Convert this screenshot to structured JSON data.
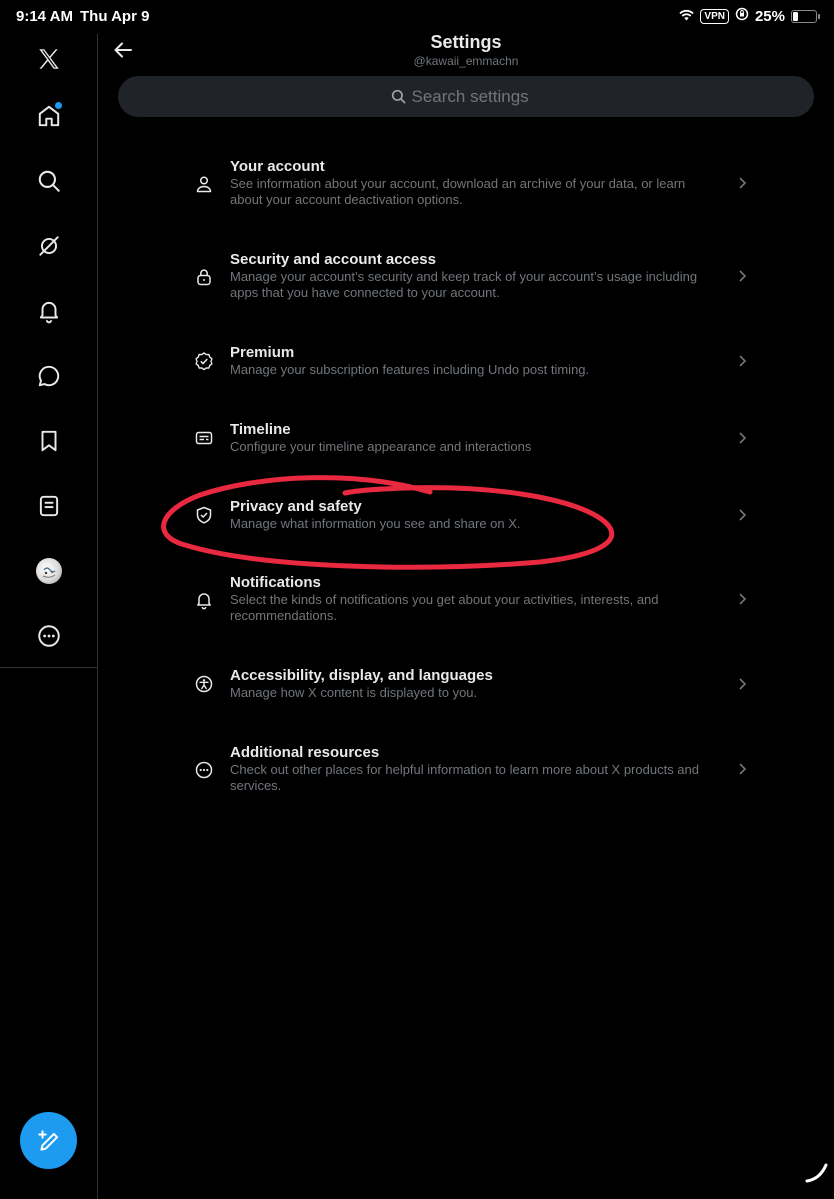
{
  "status_bar": {
    "time": "9:14 AM",
    "date": "Thu Apr 9",
    "vpn_label": "VPN",
    "battery_percent": "25%",
    "battery_level": 0.25
  },
  "sidebar": {
    "items": [
      {
        "name": "x-logo",
        "icon": "x-logo-icon"
      },
      {
        "name": "home",
        "icon": "home-icon",
        "has_notification_dot": true
      },
      {
        "name": "explore",
        "icon": "search-icon"
      },
      {
        "name": "grok",
        "icon": "grok-icon"
      },
      {
        "name": "notifications",
        "icon": "bell-icon"
      },
      {
        "name": "messages",
        "icon": "message-icon"
      },
      {
        "name": "bookmarks",
        "icon": "bookmark-icon"
      },
      {
        "name": "lists",
        "icon": "list-icon"
      },
      {
        "name": "profile",
        "icon": "avatar"
      },
      {
        "name": "more",
        "icon": "more-icon"
      }
    ],
    "compose_icon": "compose-icon"
  },
  "header": {
    "title": "Settings",
    "username": "@kawaii_emmachn"
  },
  "search": {
    "placeholder": "Search settings"
  },
  "settings": [
    {
      "title": "Your account",
      "description": "See information about your account, download an archive of your data, or learn about your account deactivation options.",
      "icon": "person-icon"
    },
    {
      "title": "Security and account access",
      "description": "Manage your account’s security and keep track of your account’s usage including apps that you have connected to your account.",
      "icon": "lock-icon"
    },
    {
      "title": "Premium",
      "description": "Manage your subscription features including Undo post timing.",
      "icon": "verified-badge-icon"
    },
    {
      "title": "Timeline",
      "description": "Configure your timeline appearance and interactions",
      "icon": "timeline-icon"
    },
    {
      "title": "Privacy and safety",
      "description": "Manage what information you see and share on X.",
      "icon": "shield-icon",
      "annotated": true
    },
    {
      "title": "Notifications",
      "description": "Select the kinds of notifications you get about your activities, interests, and recommendations.",
      "icon": "bell-icon"
    },
    {
      "title": "Accessibility, display, and languages",
      "description": "Manage how X content is displayed to you.",
      "icon": "accessibility-icon"
    },
    {
      "title": "Additional resources",
      "description": "Check out other places for helpful information to learn more about X products and services.",
      "icon": "more-circle-icon"
    }
  ],
  "colors": {
    "background": "#000000",
    "text_primary": "#e7e9ea",
    "text_secondary": "#71767b",
    "accent": "#1d9bf0",
    "search_bg": "#202327",
    "border": "#2f3336",
    "annotation": "#e8293f"
  }
}
